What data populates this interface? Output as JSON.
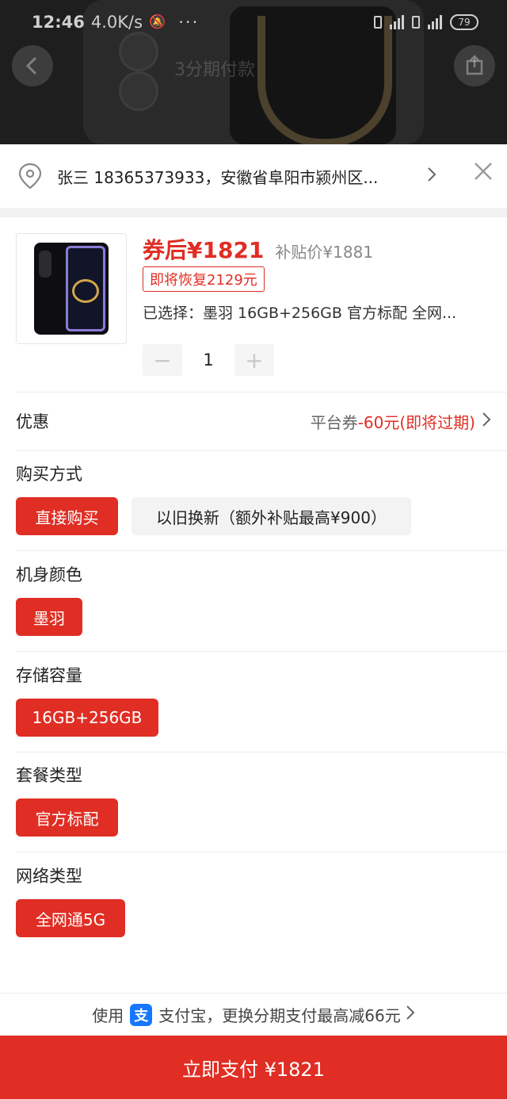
{
  "status_bar": {
    "time": "12:46",
    "network_speed": "4.0K/s",
    "more": "···",
    "battery": "79"
  },
  "background": {
    "faint_text": "3分期付款"
  },
  "address": {
    "text": "张三 18365373933，安徽省阜阳市颍州区..."
  },
  "product": {
    "price_after_coupon": "券后¥1821",
    "subsidy_price": "补贴价¥1881",
    "restore_badge": "即将恢复2129元",
    "selected_label": "已选择：墨羽 16GB+256GB 官方标配 全网...",
    "quantity": "1",
    "minus": "−",
    "plus": "+"
  },
  "promotion": {
    "label": "优惠",
    "platform": "平台券",
    "coupon": "-60元(即将过期)"
  },
  "sections": {
    "purchase_method": {
      "title": "购买方式",
      "options": [
        "直接购买",
        "以旧换新（额外补贴最高¥900）"
      ]
    },
    "color": {
      "title": "机身颜色",
      "options": [
        "墨羽"
      ]
    },
    "storage": {
      "title": "存储容量",
      "options": [
        "16GB+256GB"
      ]
    },
    "package": {
      "title": "套餐类型",
      "options": [
        "官方标配"
      ]
    },
    "network": {
      "title": "网络类型",
      "options": [
        "全网通5G"
      ]
    }
  },
  "payment_tip": {
    "prefix": "使用",
    "alipay_glyph": "支",
    "text": "支付宝，更换分期支付最高减66元"
  },
  "pay_button": {
    "label": "立即支付 ¥1821"
  },
  "colors": {
    "accent": "#e02e24",
    "alipay": "#1677ff"
  }
}
